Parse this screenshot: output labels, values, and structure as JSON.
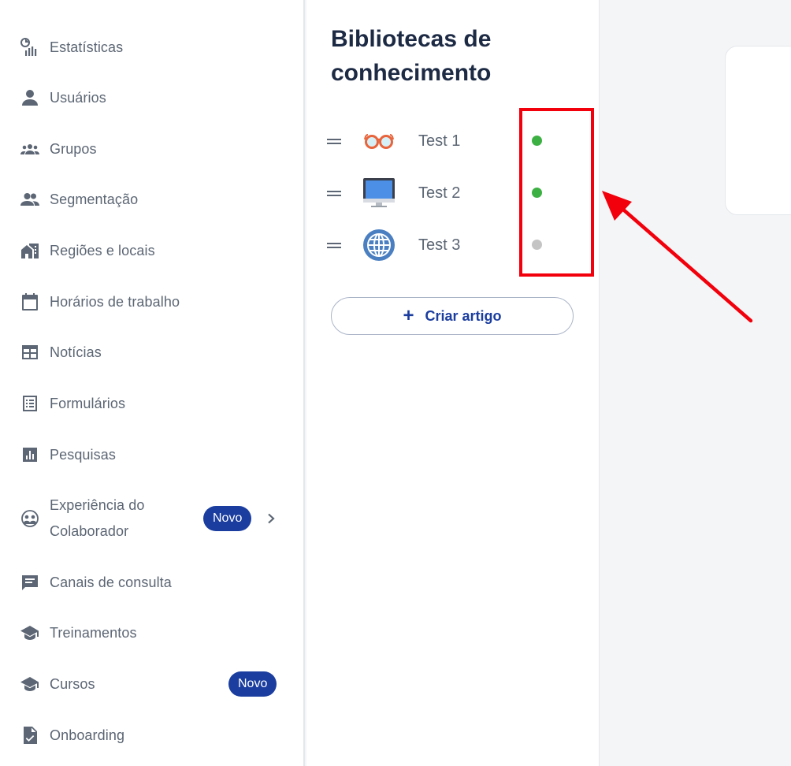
{
  "sidebar": {
    "items": [
      {
        "label": "Estatísticas",
        "icon": "statistics-icon"
      },
      {
        "label": "Usuários",
        "icon": "user-icon"
      },
      {
        "label": "Grupos",
        "icon": "groups-icon"
      },
      {
        "label": "Segmentação",
        "icon": "people-icon"
      },
      {
        "label": "Regiões e locais",
        "icon": "buildings-icon"
      },
      {
        "label": "Horários de trabalho",
        "icon": "calendar-icon"
      },
      {
        "label": "Notícias",
        "icon": "news-icon"
      },
      {
        "label": "Formulários",
        "icon": "form-list-icon"
      },
      {
        "label": "Pesquisas",
        "icon": "poll-chart-icon"
      },
      {
        "label": "Experiência do Colaborador",
        "icon": "collaborator-icon",
        "badge": "Novo",
        "chevron": "chevron-right-icon"
      },
      {
        "label": "Canais de consulta",
        "icon": "chat-icon"
      },
      {
        "label": "Treinamentos",
        "icon": "graduation-cap-icon"
      },
      {
        "label": "Cursos",
        "icon": "graduation-cap-icon",
        "badge": "Novo"
      },
      {
        "label": "Onboarding",
        "icon": "document-check-icon"
      }
    ]
  },
  "library": {
    "title": "Bibliotecas de conhecimento",
    "items": [
      {
        "name": "Test 1",
        "icon": "glasses-icon",
        "status_color": "#3cb043"
      },
      {
        "name": "Test 2",
        "icon": "monitor-icon",
        "status_color": "#3cb043"
      },
      {
        "name": "Test 3",
        "icon": "globe-icon",
        "status_color": "#c4c4c4"
      }
    ],
    "create_button": {
      "plus": "+",
      "label": "Criar artigo"
    }
  },
  "annotation": {
    "box_color": "#f2000b",
    "arrow_color": "#f2000b"
  },
  "colors": {
    "accent": "#1a3d9f",
    "text": "#5c6674",
    "title": "#1d2a44"
  }
}
